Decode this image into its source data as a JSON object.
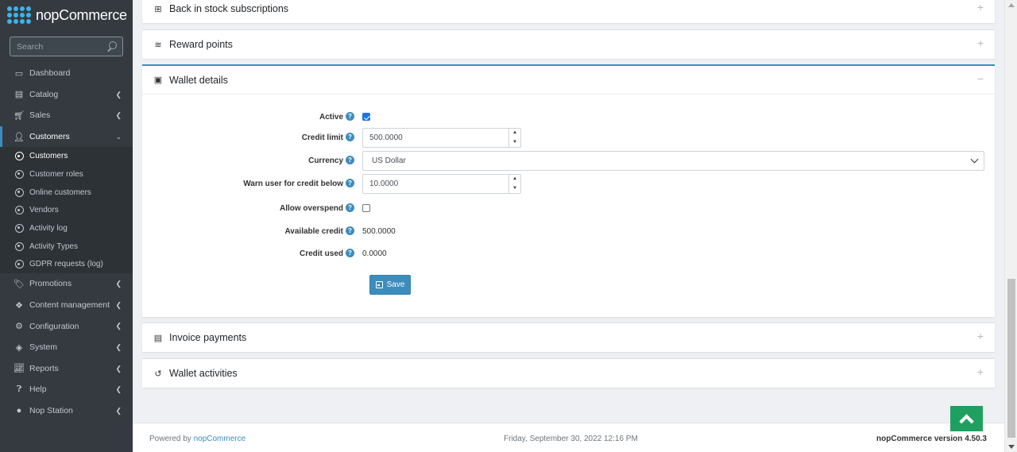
{
  "app": {
    "logo_text": "nopCommerce"
  },
  "search": {
    "placeholder": "Search"
  },
  "sidebar": {
    "items": [
      {
        "label": "Dashboard",
        "icon": "monitor-icon"
      },
      {
        "label": "Catalog",
        "icon": "book-icon"
      },
      {
        "label": "Sales",
        "icon": "cart-icon"
      },
      {
        "label": "Customers",
        "icon": "user-icon",
        "expanded": true
      },
      {
        "label": "Promotions",
        "icon": "tags-icon"
      },
      {
        "label": "Content management",
        "icon": "cubes-icon"
      },
      {
        "label": "Configuration",
        "icon": "cogs-icon"
      },
      {
        "label": "System",
        "icon": "cube-icon"
      },
      {
        "label": "Reports",
        "icon": "chart-icon"
      },
      {
        "label": "Help",
        "icon": "question-icon"
      },
      {
        "label": "Nop Station",
        "icon": "circle-icon"
      }
    ],
    "customers_sub": [
      {
        "label": "Customers"
      },
      {
        "label": "Customer roles"
      },
      {
        "label": "Online customers"
      },
      {
        "label": "Vendors"
      },
      {
        "label": "Activity log"
      },
      {
        "label": "Activity Types"
      },
      {
        "label": "GDPR requests (log)"
      }
    ]
  },
  "panels": {
    "back_in_stock": "Back in stock subscriptions",
    "reward_points": "Reward points",
    "wallet_details": "Wallet details",
    "invoice_payments": "Invoice payments",
    "wallet_activities": "Wallet activities",
    "plus": "+",
    "minus": "−"
  },
  "wallet_form": {
    "active_label": "Active",
    "active_checked": true,
    "credit_limit_label": "Credit limit",
    "credit_limit_value": "500.0000",
    "currency_label": "Currency",
    "currency_value": "US Dollar",
    "warn_label": "Warn user for credit below",
    "warn_value": "10.0000",
    "allow_overspend_label": "Allow overspend",
    "allow_overspend_checked": false,
    "available_credit_label": "Available credit",
    "available_credit_value": "500.0000",
    "credit_used_label": "Credit used",
    "credit_used_value": "0.0000",
    "save_label": "Save"
  },
  "footer": {
    "powered_prefix": "Powered by ",
    "powered_link": "nopCommerce",
    "datetime": "Friday, September 30, 2022 12:16 PM",
    "version_prefix": "nopCommerce version ",
    "version": "4.50.3"
  },
  "colors": {
    "sidebar_bg": "#343a40",
    "accent": "#3c8dbc",
    "back_to_top": "#20a060"
  }
}
